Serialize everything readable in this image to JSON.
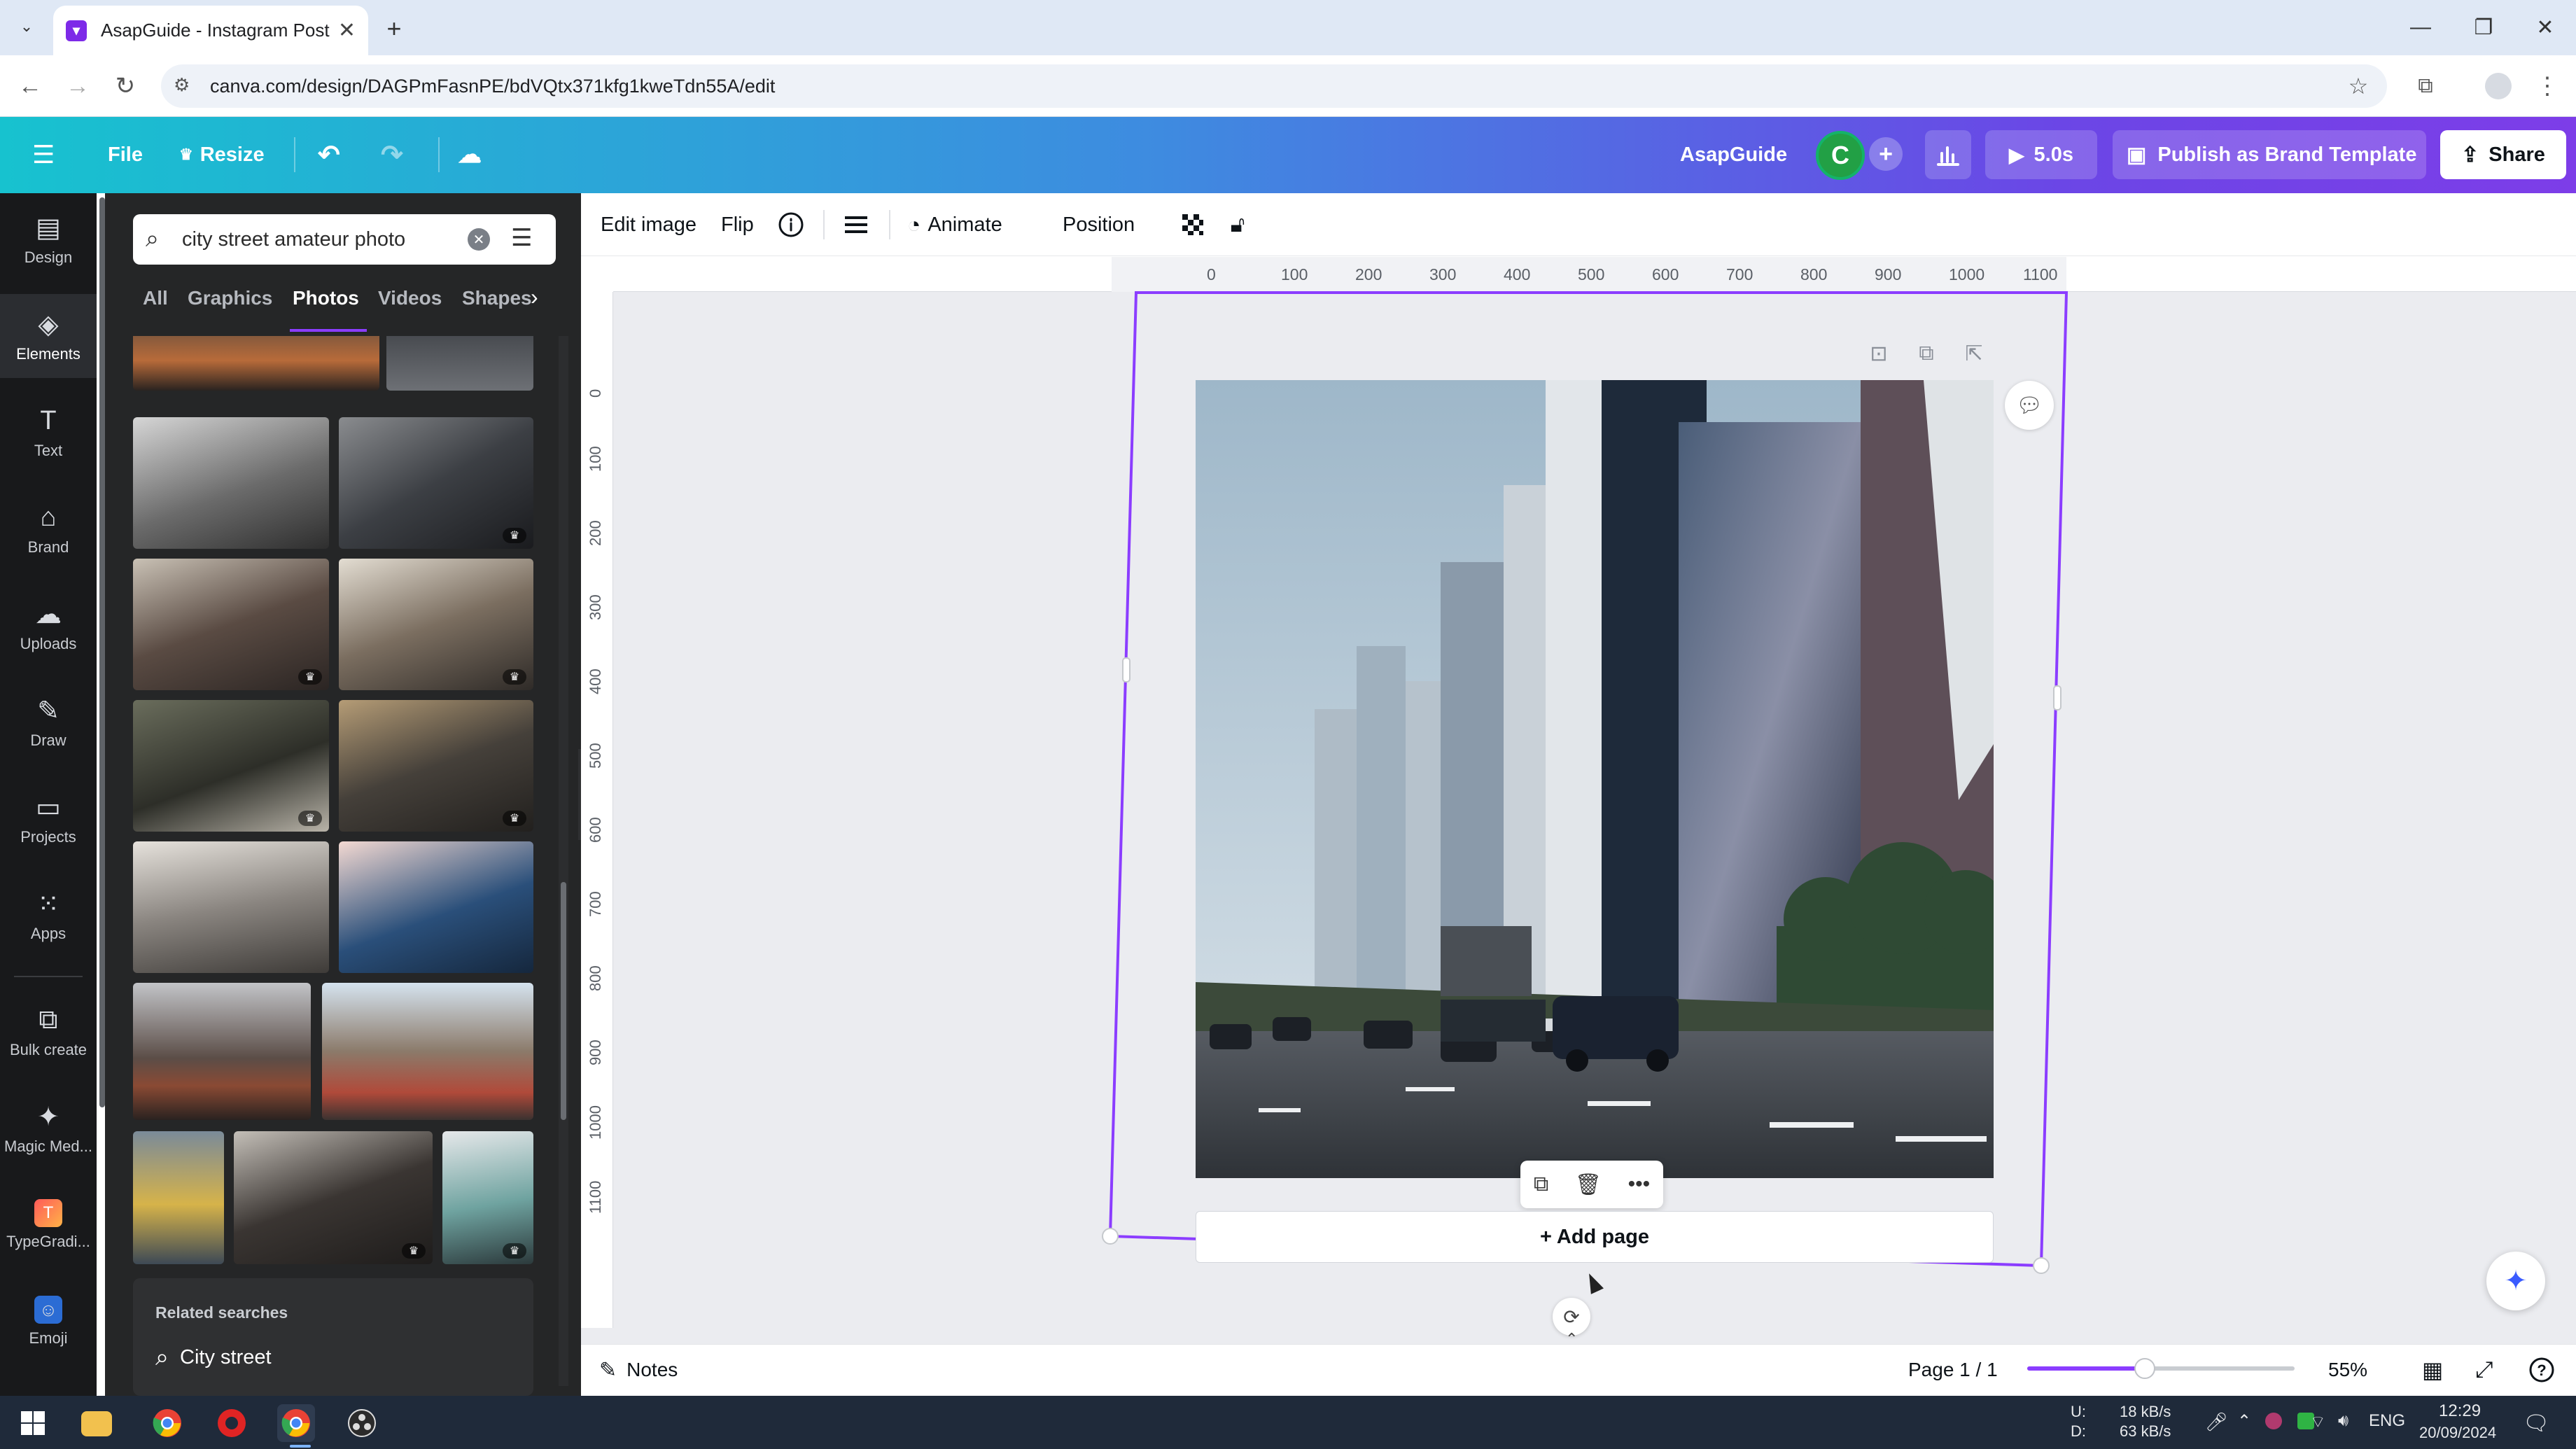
{
  "browser": {
    "tab_title": "AsapGuide - Instagram Post",
    "url": "canva.com/design/DAGPmFasnPE/bdVQtx371kfg1kweTdn55A/edit"
  },
  "header": {
    "menu": "File",
    "resize": "Resize",
    "brand_name": "AsapGuide",
    "avatar_initial": "C",
    "play_duration": "5.0s",
    "publish": "Publish as Brand Template",
    "share": "Share"
  },
  "rail": {
    "items": [
      {
        "label": "Design",
        "icon": "design-icon"
      },
      {
        "label": "Elements",
        "icon": "elements-icon"
      },
      {
        "label": "Text",
        "icon": "text-icon"
      },
      {
        "label": "Brand",
        "icon": "brand-icon"
      },
      {
        "label": "Uploads",
        "icon": "uploads-icon"
      },
      {
        "label": "Draw",
        "icon": "draw-icon"
      },
      {
        "label": "Projects",
        "icon": "projects-icon"
      },
      {
        "label": "Apps",
        "icon": "apps-icon"
      },
      {
        "label": "Bulk create",
        "icon": "bulk-create-icon"
      },
      {
        "label": "Magic Med...",
        "icon": "magic-media-icon"
      },
      {
        "label": "TypeGradi...",
        "icon": "typegradient-icon"
      },
      {
        "label": "Emoji",
        "icon": "emoji-icon"
      }
    ]
  },
  "panel": {
    "search_value": "city street amateur photo",
    "tabs": [
      "All",
      "Graphics",
      "Photos",
      "Videos",
      "Shapes"
    ],
    "active_tab": "Photos",
    "related_title": "Related searches",
    "related_item": "City street"
  },
  "toolbar": {
    "edit_image": "Edit image",
    "flip": "Flip",
    "animate": "Animate",
    "position": "Position"
  },
  "rulers": {
    "top": [
      "0",
      "100",
      "200",
      "300",
      "400",
      "500",
      "600",
      "700",
      "800",
      "900",
      "1000",
      "1100"
    ],
    "left": [
      "0",
      "100",
      "200",
      "300",
      "400",
      "500",
      "600",
      "700",
      "800",
      "900",
      "1000",
      "1100"
    ]
  },
  "canvas": {
    "add_page": "+ Add page"
  },
  "bottombar": {
    "notes": "Notes",
    "page_indicator": "Page 1 / 1",
    "zoom": "55%",
    "zoom_fraction": 0.44
  },
  "taskbar": {
    "net_up": "18 kB/s",
    "net_down": "63 kB/s",
    "net_up_label": "U:",
    "net_down_label": "D:",
    "lang": "ENG",
    "time": "12:29",
    "date": "20/09/2024"
  },
  "colors": {
    "accent": "#8b3dff",
    "selection": "#8b3dff",
    "header_start": "#17c2cf",
    "header_end": "#7d3de8"
  }
}
